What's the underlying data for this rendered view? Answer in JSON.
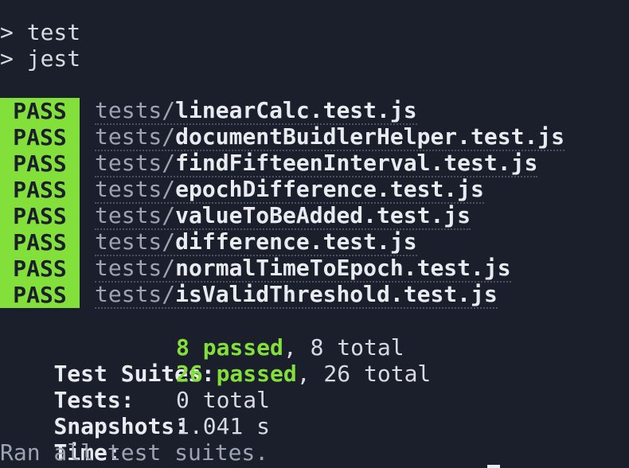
{
  "commands": [
    "> test",
    "> jest"
  ],
  "pass_label": "PASS",
  "tests": [
    {
      "dir": "tests/",
      "file": "linearCalc.test.js"
    },
    {
      "dir": "tests/",
      "file": "documentBuidlerHelper.test.js"
    },
    {
      "dir": "tests/",
      "file": "findFifteenInterval.test.js"
    },
    {
      "dir": "tests/",
      "file": "epochDifference.test.js"
    },
    {
      "dir": "tests/",
      "file": "valueToBeAdded.test.js"
    },
    {
      "dir": "tests/",
      "file": "difference.test.js"
    },
    {
      "dir": "tests/",
      "file": "normalTimeToEpoch.test.js"
    },
    {
      "dir": "tests/",
      "file": "isValidThreshold.test.js"
    }
  ],
  "summary": {
    "suites": {
      "label": "Test Suites:",
      "passed": "8 passed",
      "rest": ", 8 total"
    },
    "tests": {
      "label": "Tests:",
      "passed": "26 passed",
      "rest": ", 26 total"
    },
    "snapshots": {
      "label": "Snapshots:",
      "value": "0 total"
    },
    "time": {
      "label": "Time:",
      "value": "1.041 s"
    }
  },
  "footer": "Ran all test suites.",
  "colors": {
    "background": "#1b1f2b",
    "pass_badge": "#83e03a",
    "passed_text": "#83e03a"
  }
}
